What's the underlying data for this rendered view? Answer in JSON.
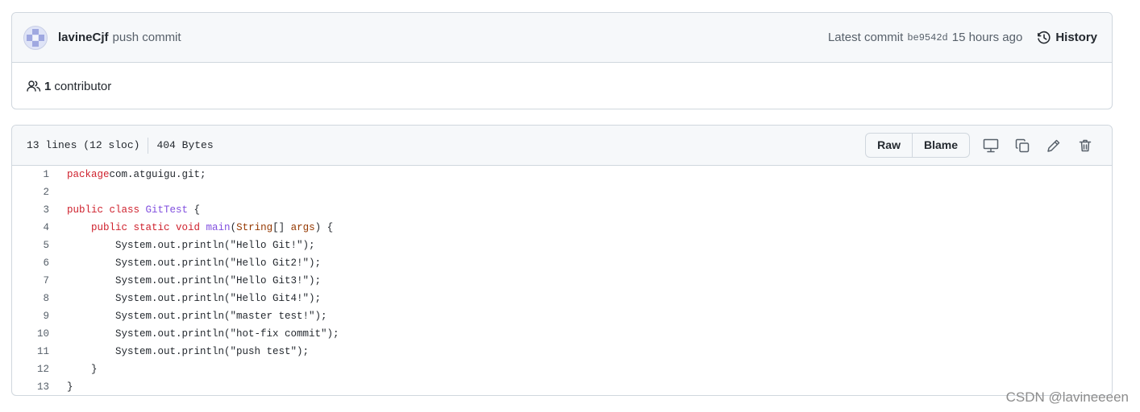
{
  "commit": {
    "author": "lavineCjf",
    "message": "push commit",
    "latest_label": "Latest commit",
    "sha": "be9542d",
    "time_ago": "15 hours ago",
    "history_label": "History",
    "contributors_count": "1",
    "contributors_label": "contributor"
  },
  "file": {
    "lines_info": "13 lines (12 sloc)",
    "size": "404 Bytes",
    "raw_label": "Raw",
    "blame_label": "Blame",
    "icons": [
      "desktop-icon",
      "copy-icon",
      "pencil-icon",
      "trash-icon"
    ]
  },
  "code": {
    "lines": [
      {
        "n": "1",
        "tokens": [
          [
            "kw",
            "package"
          ],
          [
            "",
            "com.atguigu.git;"
          ]
        ]
      },
      {
        "n": "2",
        "tokens": []
      },
      {
        "n": "3",
        "tokens": [
          [
            "kw",
            "public class "
          ],
          [
            "ty",
            "GitTest"
          ],
          [
            "",
            " {"
          ]
        ]
      },
      {
        "n": "4",
        "tokens": [
          [
            "",
            "    "
          ],
          [
            "kw",
            "public static void "
          ],
          [
            "ty",
            "main"
          ],
          [
            "",
            "("
          ],
          [
            "ty2",
            "String"
          ],
          [
            "",
            "[] "
          ],
          [
            "ty2",
            "args"
          ],
          [
            "",
            ") {"
          ]
        ]
      },
      {
        "n": "5",
        "tokens": [
          [
            "",
            "        System.out.println(\"Hello Git!\");"
          ]
        ]
      },
      {
        "n": "6",
        "tokens": [
          [
            "",
            "        System.out.println(\"Hello Git2!\");"
          ]
        ]
      },
      {
        "n": "7",
        "tokens": [
          [
            "",
            "        System.out.println(\"Hello Git3!\");"
          ]
        ]
      },
      {
        "n": "8",
        "tokens": [
          [
            "",
            "        System.out.println(\"Hello Git4!\");"
          ]
        ]
      },
      {
        "n": "9",
        "tokens": [
          [
            "",
            "        System.out.println(\"master test!\");"
          ]
        ]
      },
      {
        "n": "10",
        "tokens": [
          [
            "",
            "        System.out.println(\"hot-fix commit\");"
          ]
        ]
      },
      {
        "n": "11",
        "tokens": [
          [
            "",
            "        System.out.println(\"push test\");"
          ]
        ]
      },
      {
        "n": "12",
        "tokens": [
          [
            "",
            "    }"
          ]
        ]
      },
      {
        "n": "13",
        "tokens": [
          [
            "",
            "}"
          ]
        ]
      }
    ]
  },
  "watermark": "CSDN @lavineeeen",
  "colors": {
    "keyword": "#cf222e",
    "type": "#8250df",
    "param": "#953800",
    "border": "#d0d7de"
  }
}
